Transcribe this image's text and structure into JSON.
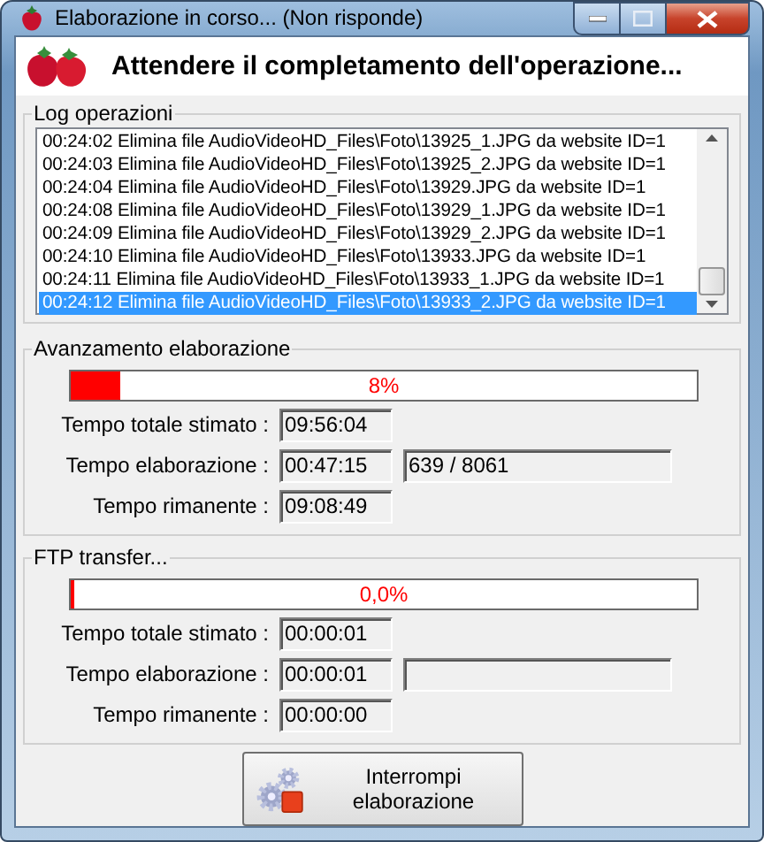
{
  "window": {
    "title": "Elaborazione in corso... (Non risponde)"
  },
  "header": {
    "title": "Attendere il completamento dell'operazione..."
  },
  "log": {
    "label": "Log operazioni",
    "entries": [
      {
        "text": "00:24:02 Elimina file AudioVideoHD_Files\\Foto\\13925_1.JPG da website ID=1",
        "selected": false
      },
      {
        "text": "00:24:03 Elimina file AudioVideoHD_Files\\Foto\\13925_2.JPG da website ID=1",
        "selected": false
      },
      {
        "text": "00:24:04 Elimina file AudioVideoHD_Files\\Foto\\13929.JPG da website ID=1",
        "selected": false
      },
      {
        "text": "00:24:08 Elimina file AudioVideoHD_Files\\Foto\\13929_1.JPG da website ID=1",
        "selected": false
      },
      {
        "text": "00:24:09 Elimina file AudioVideoHD_Files\\Foto\\13929_2.JPG da website ID=1",
        "selected": false
      },
      {
        "text": "00:24:10 Elimina file AudioVideoHD_Files\\Foto\\13933.JPG da website ID=1",
        "selected": false
      },
      {
        "text": "00:24:11 Elimina file AudioVideoHD_Files\\Foto\\13933_1.JPG da website ID=1",
        "selected": false
      },
      {
        "text": "00:24:12 Elimina file AudioVideoHD_Files\\Foto\\13933_2.JPG da website ID=1",
        "selected": true
      }
    ]
  },
  "sections": [
    {
      "label": "Avanzamento elaborazione",
      "progress": {
        "level": 0.08,
        "reading": "8%"
      },
      "rows": [
        {
          "kind": "single",
          "label": "Tempo totale stimato :",
          "value": "09:56:04"
        },
        {
          "kind": "pair",
          "label": "Tempo elaborazione :",
          "value": "00:47:15",
          "counter": "639 / 8061"
        },
        {
          "kind": "single",
          "label": "Tempo rimanente :",
          "value": "09:08:49"
        }
      ]
    },
    {
      "label": "FTP transfer...",
      "progress": {
        "level": 0.0,
        "reading": "0,0%"
      },
      "rows": [
        {
          "kind": "single",
          "label": "Tempo totale stimato :",
          "value": "00:00:01"
        },
        {
          "kind": "pair",
          "label": "Tempo elaborazione :",
          "value": "00:00:01"
        },
        {
          "kind": "single",
          "label": "Tempo rimanente :",
          "value": "00:00:00"
        }
      ]
    }
  ],
  "stop_button": {
    "label": "Interrompi elaborazione"
  }
}
